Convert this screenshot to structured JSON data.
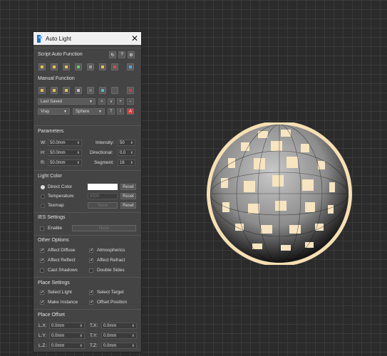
{
  "window": {
    "title": "Auto Light",
    "close_glyph": "✕"
  },
  "script_auto": {
    "header": "Script Auto Function",
    "header_icons": [
      {
        "glyph": "↻",
        "name": "refresh-icon"
      },
      {
        "glyph": "?",
        "name": "help-icon"
      },
      {
        "glyph": "⚙",
        "name": "gear-icon"
      }
    ],
    "tools": [
      {
        "name": "tool-1-icon"
      },
      {
        "name": "tool-2-icon"
      },
      {
        "name": "tool-3-icon"
      },
      {
        "name": "tool-4-icon"
      },
      {
        "name": "tool-5-icon"
      },
      {
        "name": "tool-6-icon"
      },
      {
        "name": "tool-7-icon"
      },
      {
        "name": "tool-8-icon"
      }
    ]
  },
  "manual": {
    "header": "Manual Function",
    "saved_dropdown": "Last Saved",
    "nav_buttons": [
      "<",
      "v",
      "+",
      "−"
    ],
    "renderer": "Vray",
    "shape": "Sphere",
    "small_buttons": [
      "T",
      "I",
      "A"
    ]
  },
  "parameters": {
    "header": "Parameters",
    "w_label": "W:",
    "w_value": "50.0mm",
    "h_label": "H:",
    "h_value": "50.0mm",
    "r_label": "R:",
    "r_value": "50.0mm",
    "intensity_label": "Intensity:",
    "intensity_value": "50",
    "directional_label": "Directional:",
    "directional_value": "0.0",
    "segment_label": "Segment:",
    "segment_value": "16"
  },
  "light_color": {
    "header": "Light Color",
    "direct_label": "Direct Color",
    "temperature_label": "Temperature",
    "temperature_value": "6500",
    "texmap_label": "Texmap",
    "texmap_value": "None",
    "reset": "Reset",
    "swatch_color": "#ffffff"
  },
  "ies": {
    "header": "IES Settings",
    "enable_label": "Enable",
    "file_value": "None"
  },
  "other": {
    "header": "Other Options",
    "affect_diffuse": "Affect Diffuse",
    "atmospherics": "Atmospherics",
    "affect_reflect": "Affect Reflect",
    "affect_refract": "Affect Refract",
    "cast_shadows": "Cast Shadows",
    "double_sides": "Double Sides"
  },
  "place": {
    "header": "Place Settings",
    "select_light": "Select Light",
    "select_target": "Select Target",
    "make_instance": "Make Instance",
    "offset_position": "Offset Position"
  },
  "offset": {
    "header": "Place Offset",
    "lx_label": "L.X:",
    "lx_value": "0.0mm",
    "ly_label": "L.Y:",
    "ly_value": "0.0mm",
    "lz_label": "L.Z:",
    "lz_value": "0.0mm",
    "tx_label": "T.X:",
    "tx_value": "0.0mm",
    "ty_label": "T.Y:",
    "ty_value": "0.0mm",
    "tz_label": "T.Z:",
    "tz_value": "0.0mm"
  }
}
